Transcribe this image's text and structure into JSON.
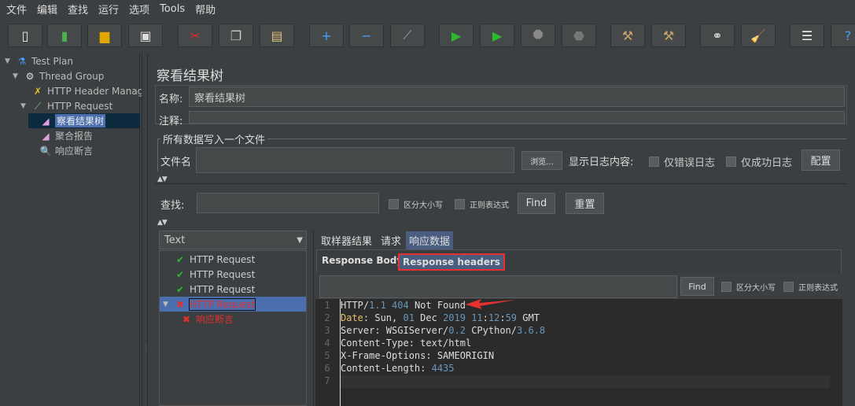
{
  "menu": [
    "文件",
    "编辑",
    "查找",
    "运行",
    "选项",
    "Tools",
    "帮助"
  ],
  "toolbar": [
    {
      "icon": "new-icon",
      "g": "▯",
      "c": "#eee"
    },
    {
      "icon": "templates-icon",
      "g": "▮",
      "c": "#4caf50"
    },
    {
      "icon": "open-icon",
      "g": "▆",
      "c": "#e0a800"
    },
    {
      "icon": "save-icon",
      "g": "▣",
      "c": "#ddd"
    },
    {
      "icon": "cut-icon",
      "g": "✂",
      "c": "#e03030"
    },
    {
      "icon": "copy-icon",
      "g": "❐",
      "c": "#ccc"
    },
    {
      "icon": "paste-icon",
      "g": "▤",
      "c": "#e0c080"
    },
    {
      "icon": "expand-icon",
      "g": "+",
      "c": "#4a9eff"
    },
    {
      "icon": "collapse-icon",
      "g": "−",
      "c": "#4a9eff"
    },
    {
      "icon": "toggle-icon",
      "g": "⟋",
      "c": "#8ab"
    },
    {
      "icon": "start-icon",
      "g": "▶",
      "c": "#2db82d"
    },
    {
      "icon": "start-no-pause-icon",
      "g": "▶",
      "c": "#2db82d"
    },
    {
      "icon": "stop-icon",
      "g": "⯃",
      "c": "#888"
    },
    {
      "icon": "shutdown-icon",
      "g": "⬣",
      "c": "#777"
    },
    {
      "icon": "clear-icon",
      "g": "⚒",
      "c": "#c9a36a"
    },
    {
      "icon": "clear-all-icon",
      "g": "⚒",
      "c": "#c9a36a"
    },
    {
      "icon": "search-icon",
      "g": "⚭",
      "c": "#ddd"
    },
    {
      "icon": "reset-search-icon",
      "g": "🧹",
      "c": "#e8c020"
    },
    {
      "icon": "function-helper-icon",
      "g": "☰",
      "c": "#eee"
    },
    {
      "icon": "help-icon",
      "g": "?",
      "c": "#4a9eff"
    }
  ],
  "tree": [
    {
      "label": "Test Plan",
      "icon": "flask-icon",
      "g": "⚗",
      "c": "#4a9eff",
      "level": 0,
      "toggle": "▼"
    },
    {
      "label": "Thread Group",
      "icon": "gear-icon",
      "g": "⚙",
      "c": "#ddd",
      "level": 1,
      "toggle": "▼"
    },
    {
      "label": "HTTP Header Manag",
      "icon": "tools-icon",
      "g": "✗",
      "c": "#e8c020",
      "level": 2,
      "toggle": ""
    },
    {
      "label": "HTTP Request",
      "icon": "pipette-icon",
      "g": "⟋",
      "c": "#7c7",
      "level": 2,
      "toggle": "▼"
    },
    {
      "label": "察看结果树",
      "icon": "graph-icon",
      "g": "◢",
      "c": "#e0a0e0",
      "level": 3,
      "toggle": "",
      "selected": true
    },
    {
      "label": "聚合报告",
      "icon": "graph-icon",
      "g": "◢",
      "c": "#e0a0e0",
      "level": 3,
      "toggle": ""
    },
    {
      "label": "响应断言",
      "icon": "magnifier-icon",
      "g": "🔍",
      "c": "#9cf",
      "level": 3,
      "toggle": ""
    }
  ],
  "main": {
    "title": "察看结果树",
    "name_label": "名称:",
    "name_value": "察看结果树",
    "comment_label": "注释:",
    "comment_value": "",
    "file_group": "所有数据写入一个文件",
    "file_label": "文件名",
    "file_value": "",
    "browse": "浏览...",
    "log_label": "显示日志内容:",
    "errors_only": "仅错误日志",
    "success_only": "仅成功日志",
    "configure": "配置",
    "search_label": "查找:",
    "search_value": "",
    "case_sensitive": "区分大小写",
    "regex": "正则表达式",
    "find_btn": "Find",
    "reset_btn": "重置",
    "renderer": "Text",
    "results": [
      {
        "label": "HTTP Request",
        "status": "success"
      },
      {
        "label": "HTTP Request",
        "status": "success"
      },
      {
        "label": "HTTP Request",
        "status": "success"
      },
      {
        "label": "HTTP Request",
        "status": "failure",
        "selected": true
      },
      {
        "label": "响应断言",
        "status": "failure",
        "child": true
      }
    ],
    "tabs": [
      "取样器结果",
      "请求",
      "响应数据"
    ],
    "active_tab": "响应数据",
    "subtabs": [
      "Response Body",
      "Response headers"
    ],
    "active_subtab": "Response headers",
    "find_value": "",
    "find_case": "区分大小写",
    "find_regex": "正则表达式",
    "code_lines": [
      [
        [
          "t",
          "HTTP/"
        ],
        [
          "n",
          "1.1"
        ],
        [
          "t",
          " "
        ],
        [
          "n",
          "404"
        ],
        [
          "t",
          " Not Found"
        ]
      ],
      [
        [
          "k",
          "Date"
        ],
        [
          "t",
          ": Sun, "
        ],
        [
          "n",
          "01"
        ],
        [
          "t",
          " Dec "
        ],
        [
          "n",
          "2019"
        ],
        [
          "t",
          " "
        ],
        [
          "n",
          "11"
        ],
        [
          "t",
          ":"
        ],
        [
          "n",
          "12"
        ],
        [
          "t",
          ":"
        ],
        [
          "n",
          "59"
        ],
        [
          "t",
          " GMT"
        ]
      ],
      [
        [
          "t",
          "Server: WSGIServer/"
        ],
        [
          "n",
          "0.2"
        ],
        [
          "t",
          " CPython/"
        ],
        [
          "n",
          "3.6.8"
        ]
      ],
      [
        [
          "t",
          "Content-Type: text/html"
        ]
      ],
      [
        [
          "t",
          "X-Frame-Options: SAMEORIGIN"
        ]
      ],
      [
        [
          "t",
          "Content-Length: "
        ],
        [
          "n",
          "4435"
        ]
      ],
      []
    ]
  },
  "colors": {
    "annotation": "#e83030",
    "selection": "#4b6eaf",
    "tree_selection": "#0d293e"
  }
}
